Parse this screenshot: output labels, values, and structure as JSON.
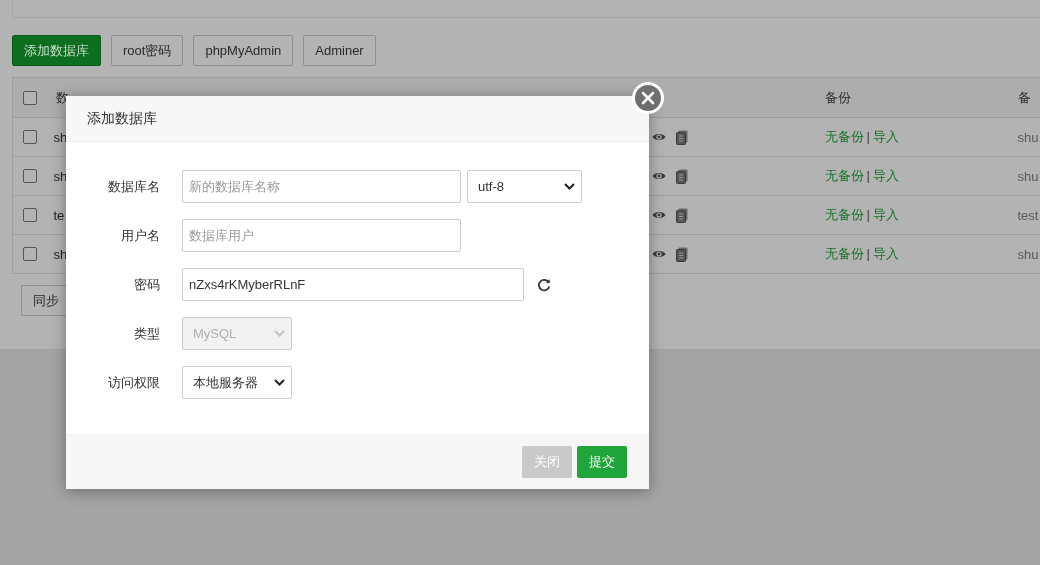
{
  "toolbar": {
    "buttons": [
      {
        "label": "添加数据库",
        "kind": "primary"
      },
      {
        "label": "root密码",
        "kind": "default"
      },
      {
        "label": "phpMyAdmin",
        "kind": "default"
      },
      {
        "label": "Adminer",
        "kind": "default"
      }
    ]
  },
  "table": {
    "header_checked": false,
    "columns": [
      {
        "label": "数"
      },
      {
        "label": "备份"
      },
      {
        "label": "备"
      }
    ],
    "rows": [
      {
        "checked": false,
        "name": "sh",
        "backup": "无备份",
        "import": "导入",
        "remark": "shu"
      },
      {
        "checked": false,
        "name": "sh",
        "backup": "无备份",
        "import": "导入",
        "remark": "shu"
      },
      {
        "checked": false,
        "name": "te",
        "backup": "无备份",
        "import": "导入",
        "remark": "test"
      },
      {
        "checked": false,
        "name": "sh",
        "backup": "无备份",
        "import": "导入",
        "remark": "shu"
      }
    ],
    "separator": "|"
  },
  "sync_button": {
    "label": "同步"
  },
  "dialog": {
    "title": "添加数据库",
    "fields": [
      {
        "kind": "text-select",
        "label": "数据库名",
        "placeholder": "新的数据库名称",
        "option": "utf-8"
      },
      {
        "kind": "text",
        "label": "用户名",
        "placeholder": "数据库用户"
      },
      {
        "kind": "password",
        "label": "密码",
        "value": "nZxs4rKMyberRLnF"
      },
      {
        "kind": "select",
        "label": "类型",
        "value": "MySQL",
        "disabled": true
      },
      {
        "kind": "select",
        "label": "访问权限",
        "value": "本地服务器",
        "disabled": false
      }
    ],
    "buttons": [
      {
        "label": "关闭",
        "kind": "cancel"
      },
      {
        "label": "提交",
        "kind": "submit"
      }
    ]
  }
}
